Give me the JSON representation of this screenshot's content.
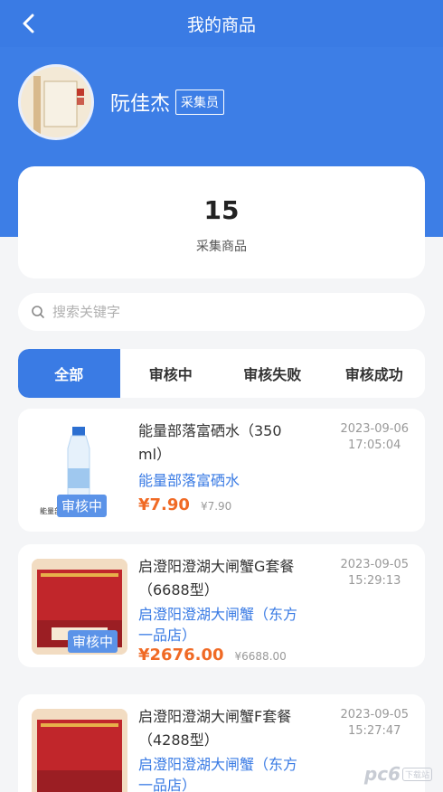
{
  "header": {
    "title": "我的商品",
    "back_icon": "chevron-left-icon"
  },
  "profile": {
    "name": "阮佳杰",
    "role": "采集员",
    "avatar_text": "诸事皆顺"
  },
  "stats": {
    "count": "15",
    "label": "采集商品"
  },
  "search": {
    "placeholder": "搜索关键字",
    "icon": "search-icon"
  },
  "tabs": [
    {
      "label": "全部",
      "active": true
    },
    {
      "label": "审核中",
      "active": false
    },
    {
      "label": "审核失败",
      "active": false
    },
    {
      "label": "审核成功",
      "active": false
    }
  ],
  "products": [
    {
      "name": "能量部落富硒水（350 ml）",
      "shop": "能量部落富硒水",
      "price": "¥7.90",
      "original_price": "¥7.90",
      "date": "2023-09-06",
      "time": "17:05:04",
      "status": "审核中",
      "thumb_text": "能量部落"
    },
    {
      "name": "启澄阳澄湖大闸蟹G套餐（6688型）",
      "shop": "启澄阳澄湖大闸蟹（东方一品店）",
      "price": "¥2676.00",
      "original_price": "¥6688.00",
      "date": "2023-09-05",
      "time": "15:29:13",
      "status": "审核中"
    },
    {
      "name": "启澄阳澄湖大闸蟹F套餐（4288型）",
      "shop": "启澄阳澄湖大闸蟹（东方一品店）",
      "date": "2023-09-05",
      "time": "15:27:47"
    }
  ],
  "watermark": {
    "text": "pc6",
    "sub": "下载站"
  },
  "colors": {
    "primary": "#3a7be4",
    "price": "#f06a25",
    "badge": "#5b93e8"
  }
}
